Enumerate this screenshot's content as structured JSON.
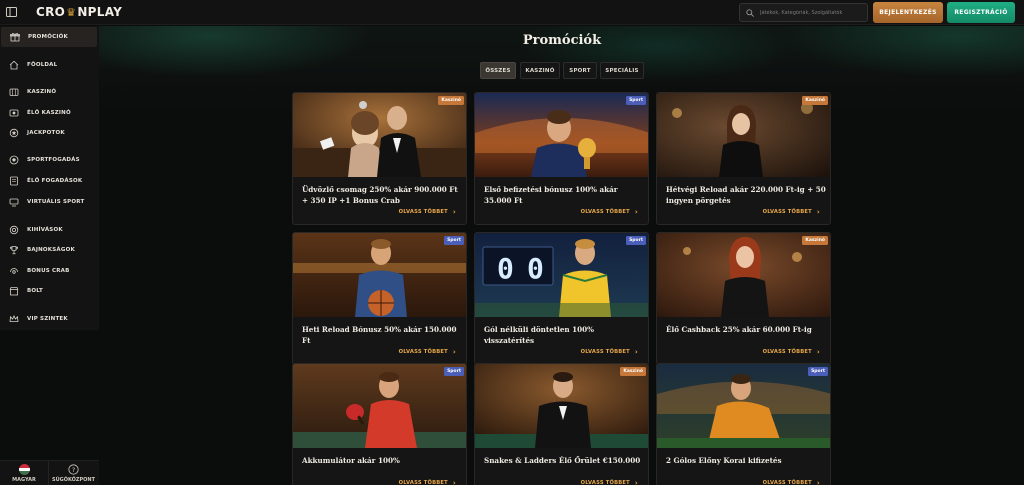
{
  "header": {
    "logo_left": "CRO",
    "logo_right": "NPLAY",
    "search_placeholder": "Játékok, Kategóriák, Szolgáltatók",
    "login_label": "BEJELENTKEZÉS",
    "register_label": "REGISZTRÁCIÓ"
  },
  "sidebar": {
    "items": [
      {
        "label": "PROMÓCIÓK",
        "icon": "gift-icon"
      },
      {
        "label": "FŐOLDAL",
        "icon": "home-icon"
      },
      {
        "label": "KASZINÓ",
        "icon": "slot-icon"
      },
      {
        "label": "ÉLŐ KASZINÓ",
        "icon": "live-casino-icon"
      },
      {
        "label": "JACKPOTOK",
        "icon": "jackpot-icon"
      },
      {
        "label": "SPORTFOGADÁS",
        "icon": "soccer-ball-icon"
      },
      {
        "label": "ÉLŐ FOGADÁSOK",
        "icon": "live-bet-icon"
      },
      {
        "label": "VIRTUÁLIS SPORT",
        "icon": "virtual-sport-icon"
      },
      {
        "label": "KIHÍVÁSOK",
        "icon": "challenge-icon"
      },
      {
        "label": "BAJNOKSÁGOK",
        "icon": "trophy-icon"
      },
      {
        "label": "BONUS CRAB",
        "icon": "bonus-crab-icon"
      },
      {
        "label": "BOLT",
        "icon": "shop-icon"
      },
      {
        "label": "VIP SZINTEK",
        "icon": "crown-icon"
      }
    ],
    "language_label": "MAGYAR",
    "help_label": "SÚGÓKÖZPONT"
  },
  "main": {
    "title": "Promóciók",
    "tabs": [
      {
        "label": "ÖSSZES",
        "active": true
      },
      {
        "label": "KASZINÓ",
        "active": false
      },
      {
        "label": "SPORT",
        "active": false
      },
      {
        "label": "SPECIÁLIS",
        "active": false
      }
    ],
    "read_more": "OLVASS TÖBBET",
    "cards": [
      {
        "title": "Üdvözlő csomag 250% akár 900.000 Ft + 350 IP +1 Bonus Crab",
        "badge": "Kaszinó",
        "type": "kaszino",
        "image": "casino-couple"
      },
      {
        "title": "Első befizetési bónusz 100% akár 35.000 Ft",
        "badge": "Sport",
        "type": "sport",
        "image": "trophy-player"
      },
      {
        "title": "Hétvégi Reload akár 220.000 Ft-ig + 50 ingyen pörgetés",
        "badge": "Kaszinó",
        "type": "kaszino",
        "image": "casino-lady"
      },
      {
        "title": "Heti Reload Bónusz 50% akár 150.000 Ft",
        "badge": "Sport",
        "type": "sport",
        "image": "basketball-player"
      },
      {
        "title": "Gól nélküli döntetlen 100% visszatérítés",
        "badge": "Sport",
        "type": "sport",
        "image": "scoreboard-player"
      },
      {
        "title": "Élő Cashback 25% akár 60.000 Ft-ig",
        "badge": "Kaszinó",
        "type": "kaszino",
        "image": "casino-redhead"
      },
      {
        "title": "Akkumulátor akár 100%",
        "badge": "Sport",
        "type": "sport",
        "image": "table-tennis"
      },
      {
        "title": "Snakes & Ladders Élő Őrület €150.000",
        "badge": "Kaszinó",
        "type": "kaszino",
        "image": "casino-dealer"
      },
      {
        "title": "2 Gólos Előny Korai kifizetés",
        "badge": "Sport",
        "type": "sport",
        "image": "stadium-player"
      }
    ]
  },
  "colors": {
    "accent_gold": "#e9a84a",
    "login_orange": "#b8733a",
    "register_green": "#1a9e78",
    "badge_casino": "#c5783a",
    "badge_sport": "#4b5fb8"
  }
}
